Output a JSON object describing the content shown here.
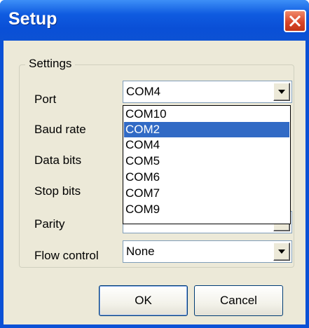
{
  "window": {
    "title": "Setup"
  },
  "group": {
    "label": "Settings"
  },
  "fields": [
    {
      "label": "Port",
      "value": "COM4"
    },
    {
      "label": "Baud rate"
    },
    {
      "label": "Data bits"
    },
    {
      "label": "Stop bits"
    },
    {
      "label": "Parity"
    },
    {
      "label": "Flow control",
      "value": "None"
    }
  ],
  "port_dropdown": {
    "options": [
      "COM10",
      "COM2",
      "COM4",
      "COM5",
      "COM6",
      "COM7",
      "COM9"
    ],
    "highlighted": "COM2"
  },
  "buttons": {
    "ok": "OK",
    "cancel": "Cancel"
  },
  "colors": {
    "title_bar": "#0a4fd6",
    "selection": "#316ac5",
    "dialog_face": "#ece9d8",
    "close_button": "#d9462a"
  }
}
